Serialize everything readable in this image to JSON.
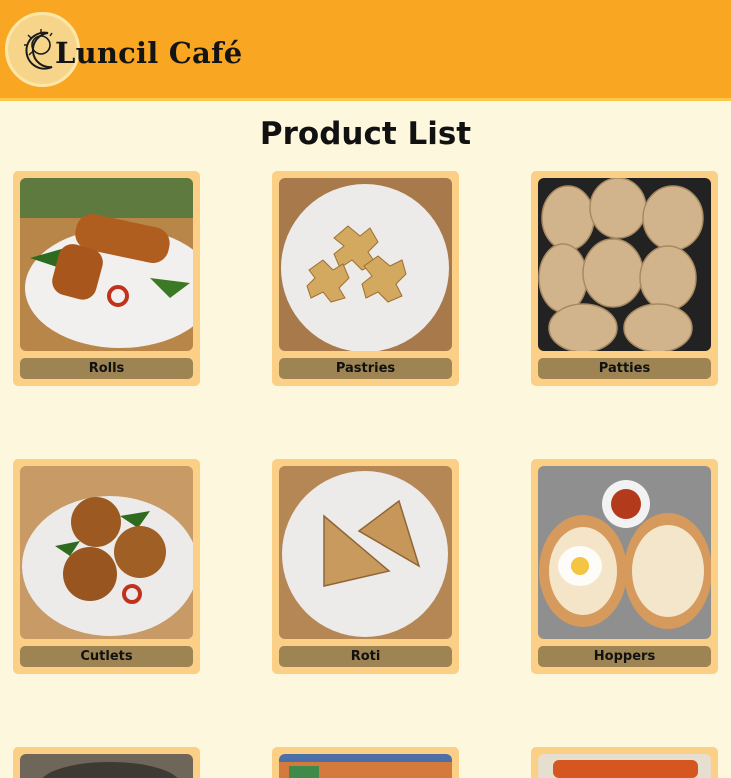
{
  "header": {
    "brand": "Luncil Café",
    "logo_icon": "moon-sun-logo-icon"
  },
  "page": {
    "title": "Product List"
  },
  "products": [
    {
      "label": "Rolls"
    },
    {
      "label": "Pastries"
    },
    {
      "label": "Patties"
    },
    {
      "label": "Cutlets"
    },
    {
      "label": "Roti"
    },
    {
      "label": "Hoppers"
    }
  ],
  "colors": {
    "header": "#f9a623",
    "background": "#fdf7dd",
    "card": "#fbcf86",
    "label_bar": "#9d8452"
  }
}
